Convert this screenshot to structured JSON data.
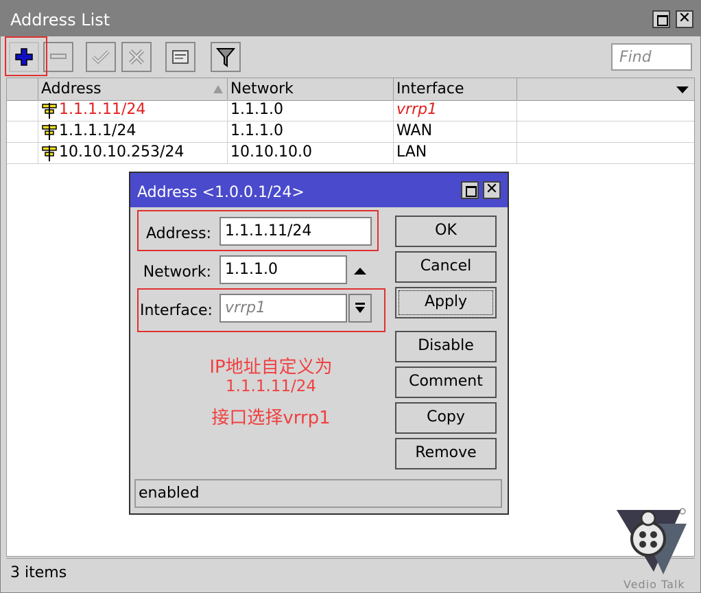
{
  "window": {
    "title": "Address List"
  },
  "toolbar": {
    "find_placeholder": "Find"
  },
  "table": {
    "columns": [
      "Address",
      "Network",
      "Interface"
    ],
    "rows": [
      {
        "address": "1.1.1.11/24",
        "network": "1.1.1.0",
        "interface": "vrrp1"
      },
      {
        "address": "1.1.1.1/24",
        "network": "1.1.1.0",
        "interface": "WAN"
      },
      {
        "address": "10.10.10.253/24",
        "network": "10.10.10.0",
        "interface": "LAN"
      }
    ]
  },
  "status": {
    "count": "3 items"
  },
  "dialog": {
    "title": "Address <1.0.0.1/24>",
    "address_label": "Address:",
    "address_value": "1.1.1.11/24",
    "network_label": "Network:",
    "network_value": "1.1.1.0",
    "interface_label": "Interface:",
    "interface_value": "vrrp1",
    "buttons": {
      "ok": "OK",
      "cancel": "Cancel",
      "apply": "Apply",
      "disable": "Disable",
      "comment": "Comment",
      "copy": "Copy",
      "remove": "Remove"
    },
    "status": "enabled"
  },
  "annotation": {
    "line1": "IP地址自定义为",
    "line2": "1.1.1.11/24",
    "line3": "接口选择vrrp1"
  },
  "watermark": {
    "text": "Vedio Talk"
  },
  "colors": {
    "accent_title": "#4a4acc",
    "highlight_red": "#e03030",
    "inactive_title": "#808080"
  }
}
